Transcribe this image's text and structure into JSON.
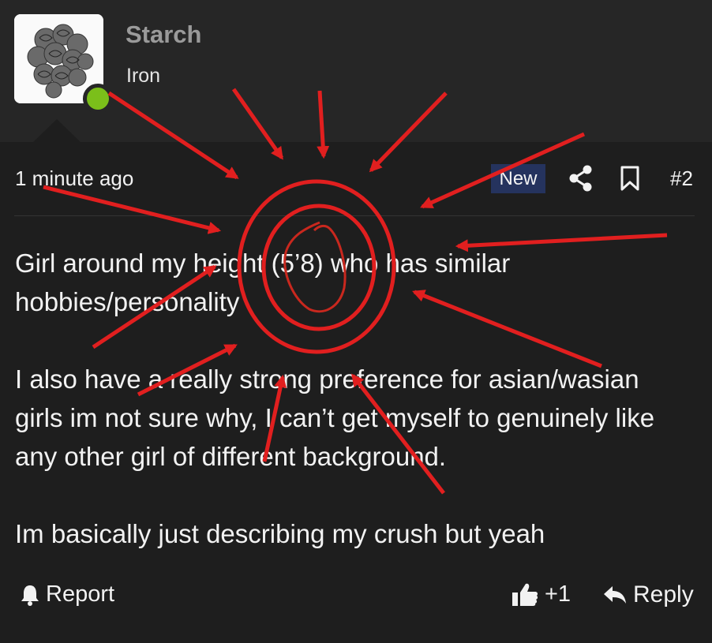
{
  "post": {
    "author": {
      "username": "Starch",
      "rank": "Iron",
      "online_status_color": "#7bbf1a"
    },
    "timestamp": "1 minute ago",
    "badge": "New",
    "post_number": "#2",
    "paragraphs": [
      "Girl around my height (5’8) who has similar hobbies/personality",
      "I also have a really strong preference for asian/wasian girls im not sure why, I can’t get myself to genuinely like any other girl of different background.",
      "Im basically just describing my crush but yeah"
    ]
  },
  "actions": {
    "report_label": "Report",
    "like_count": "+1",
    "reply_label": "Reply"
  },
  "icons": {
    "share": "share-icon",
    "bookmark": "bookmark-icon",
    "report": "bell-icon",
    "like": "thumbs-up-icon",
    "reply": "reply-arrow-icon"
  },
  "colors": {
    "background": "#1e1e1e",
    "header_background": "#262626",
    "badge_background": "#25335e",
    "annotation_red": "#e11f1f"
  }
}
